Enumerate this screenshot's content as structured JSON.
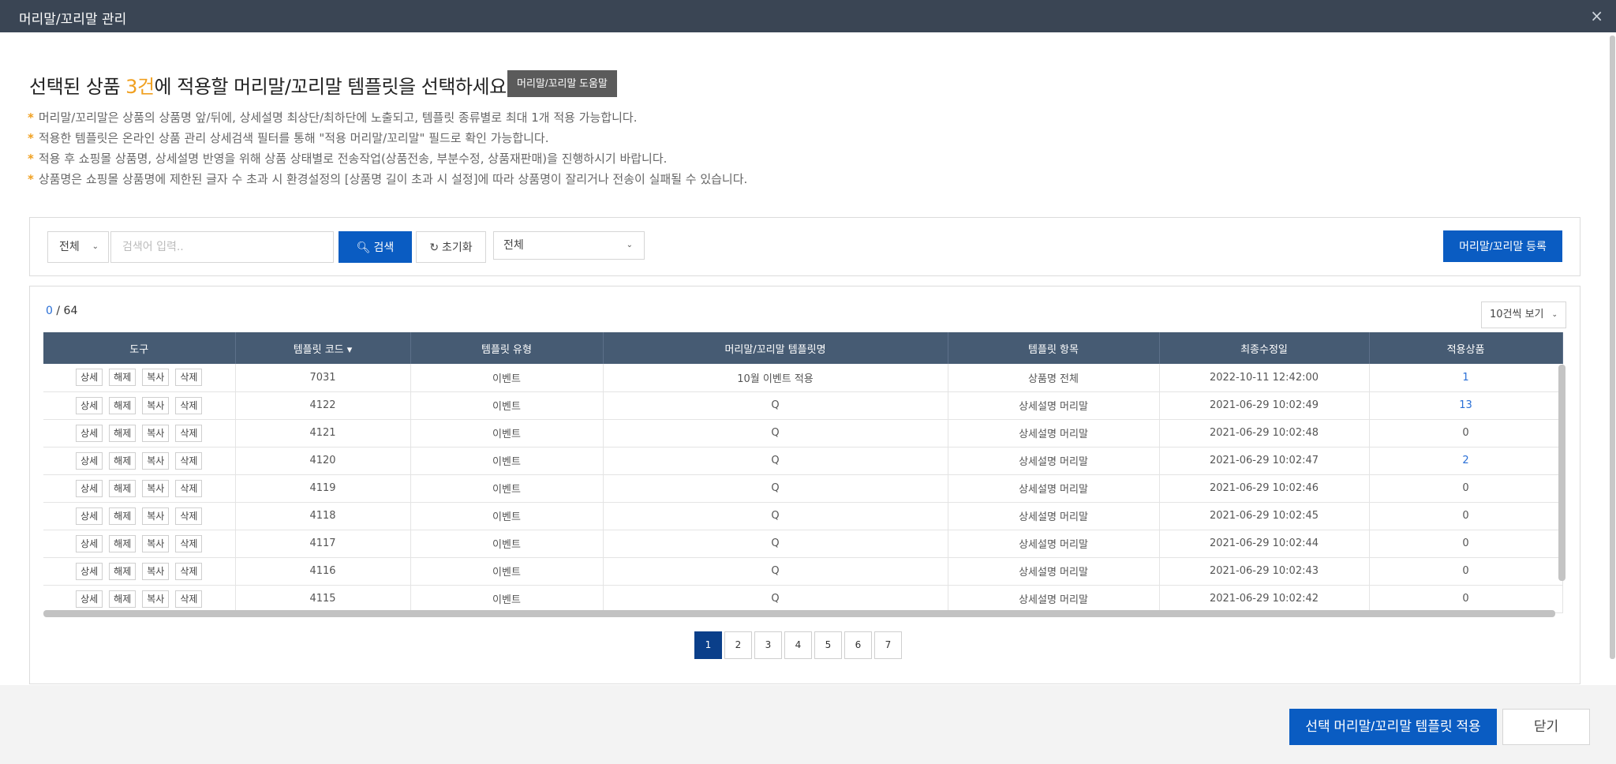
{
  "window": {
    "title": "머리말/꼬리말 관리",
    "close_icon": "×"
  },
  "heading": {
    "prefix": "선택된 상품 ",
    "count": "3건",
    "suffix": "에 적용할 머리말/꼬리말 템플릿을 선택하세요."
  },
  "help_button": "머리말/꼬리말 도움말",
  "notes": [
    "머리말/꼬리말은 상품의 상품명 앞/뒤에, 상세설명 최상단/최하단에 노출되고, 템플릿 종류별로 최대 1개 적용 가능합니다.",
    "적용한 템플릿은 온라인 상품 관리 상세검색 필터를 통해 \"적용 머리말/꼬리말\" 필드로 확인 가능합니다.",
    "적용 후 쇼핑몰 상품명, 상세설명 반영을 위해 상품 상태별로 전송작업(상품전송, 부분수정, 상품재판매)을 진행하시기 바랍니다.",
    "상품명은 쇼핑몰 상품명에 제한된 글자 수 초과 시 환경설정의 [상품명 길이 초과 시 설정]에 따라 상품명이 잘리거나 전송이 실패될 수 있습니다."
  ],
  "search": {
    "scope": "전체",
    "placeholder": "검색어 입력..",
    "search_label": "검색",
    "reset_label": "초기화",
    "type_filter": "전체",
    "register_label": "머리말/꼬리말 등록"
  },
  "list": {
    "selected": "0",
    "total": "/ 64",
    "page_size": "10건씩 보기",
    "columns": [
      "도구",
      "템플릿 코드",
      "템플릿 유형",
      "머리말/꼬리말 템플릿명",
      "템플릿 항목",
      "최종수정일",
      "적용상품"
    ],
    "tools": [
      "상세",
      "해제",
      "복사",
      "삭제"
    ],
    "rows": [
      {
        "code": "7031",
        "type": "이벤트",
        "name": "10월 이벤트 적용",
        "item": "상품명 전체",
        "modified": "2022-10-11 12:42:00",
        "applied": "1",
        "link": true
      },
      {
        "code": "4122",
        "type": "이벤트",
        "name": "Q",
        "item": "상세설명 머리말",
        "modified": "2021-06-29 10:02:49",
        "applied": "13",
        "link": true
      },
      {
        "code": "4121",
        "type": "이벤트",
        "name": "Q",
        "item": "상세설명 머리말",
        "modified": "2021-06-29 10:02:48",
        "applied": "0",
        "link": false
      },
      {
        "code": "4120",
        "type": "이벤트",
        "name": "Q",
        "item": "상세설명 머리말",
        "modified": "2021-06-29 10:02:47",
        "applied": "2",
        "link": true
      },
      {
        "code": "4119",
        "type": "이벤트",
        "name": "Q",
        "item": "상세설명 머리말",
        "modified": "2021-06-29 10:02:46",
        "applied": "0",
        "link": false
      },
      {
        "code": "4118",
        "type": "이벤트",
        "name": "Q",
        "item": "상세설명 머리말",
        "modified": "2021-06-29 10:02:45",
        "applied": "0",
        "link": false
      },
      {
        "code": "4117",
        "type": "이벤트",
        "name": "Q",
        "item": "상세설명 머리말",
        "modified": "2021-06-29 10:02:44",
        "applied": "0",
        "link": false
      },
      {
        "code": "4116",
        "type": "이벤트",
        "name": "Q",
        "item": "상세설명 머리말",
        "modified": "2021-06-29 10:02:43",
        "applied": "0",
        "link": false
      },
      {
        "code": "4115",
        "type": "이벤트",
        "name": "Q",
        "item": "상세설명 머리말",
        "modified": "2021-06-29 10:02:42",
        "applied": "0",
        "link": false
      }
    ]
  },
  "pagination": {
    "pages": [
      "1",
      "2",
      "3",
      "4",
      "5",
      "6",
      "7"
    ],
    "current": "1"
  },
  "footer": {
    "apply_label": "선택 머리말/꼬리말 템플릿 적용",
    "close_label": "닫기"
  },
  "colors": {
    "primary": "#0a5cc2",
    "header": "#3a4554",
    "table_header": "#465b73",
    "accent": "#f0a020",
    "link": "#2a6fd6"
  }
}
